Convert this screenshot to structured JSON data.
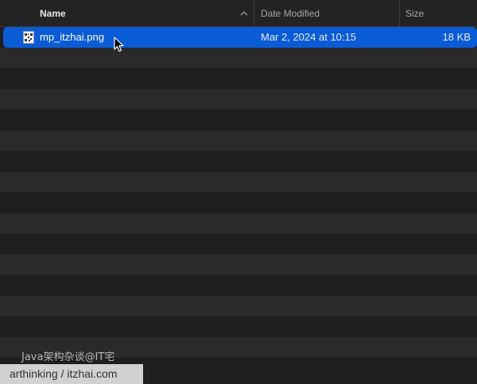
{
  "header": {
    "name_label": "Name",
    "date_label": "Date Modified",
    "size_label": "Size",
    "sort": "ascending"
  },
  "files": [
    {
      "name": "mp_itzhai.png",
      "date_modified": "Mar 2, 2024 at 10:15",
      "size": "18 KB",
      "icon": "png-file-icon",
      "selected": true
    }
  ],
  "watermark": {
    "top_text": "Java架构杂谈@IT宅",
    "box_text": "arthinking / itzhai.com"
  },
  "colors": {
    "selection": "#0a5bd6",
    "row_even": "#1e1e1e",
    "row_odd": "#2a2a2a"
  }
}
